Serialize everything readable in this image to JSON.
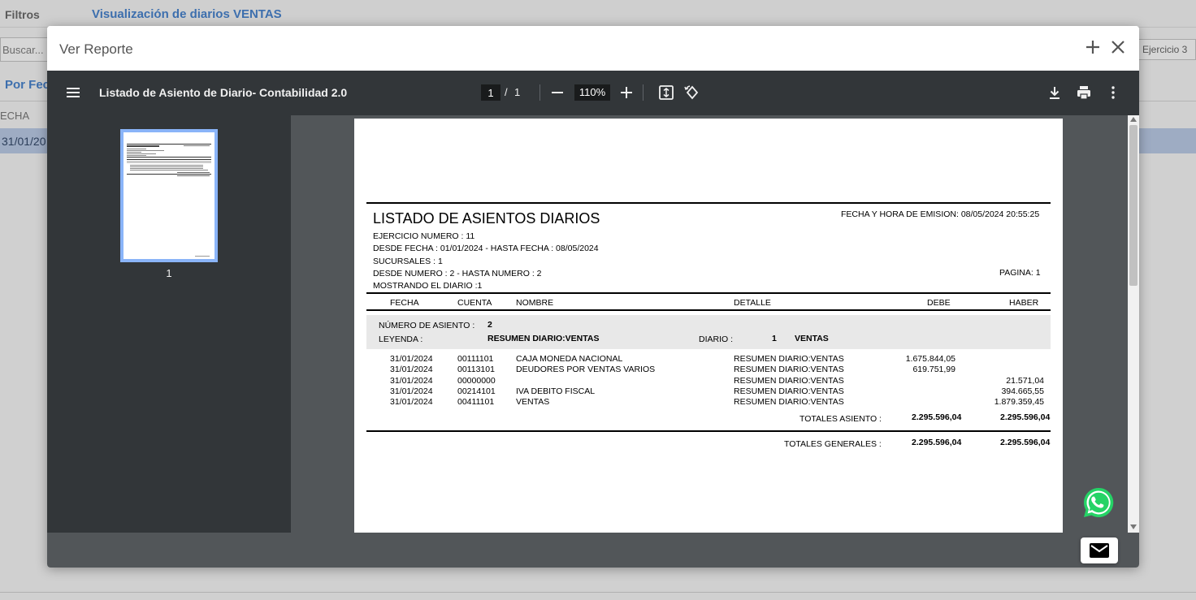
{
  "background": {
    "filtros_label": "Filtros",
    "page_title": "Visualización de diarios VENTAS",
    "search_placeholder": "Buscar...",
    "ejercicio_label": "Ejercicio 3",
    "tab_label": "Por Fec",
    "column_header": "ECHA",
    "row_date": "31/01/20"
  },
  "modal": {
    "title": "Ver Reporte"
  },
  "viewer": {
    "document_title": "Listado de Asiento de Diario- Contabilidad 2.0",
    "current_page": "1",
    "page_separator": "/",
    "total_pages": "1",
    "zoom": "110%",
    "thumbnail_label": "1"
  },
  "report": {
    "title": "LISTADO DE ASIENTOS DIARIOS",
    "emission": "FECHA Y HORA DE EMISION: 08/05/2024 20:55:25",
    "ejercicio": "EJERCICIO NUMERO : 11",
    "fechas": "DESDE FECHA : 01/01/2024 - HASTA FECHA : 08/05/2024",
    "sucursales": "SUCURSALES : 1",
    "numeros": "DESDE NUMERO : 2 - HASTA NUMERO : 2",
    "pagina": "PAGINA: 1",
    "mostrando": "MOSTRANDO EL DIARIO :1",
    "columns": {
      "fecha": "FECHA",
      "cuenta": "CUENTA",
      "nombre": "NOMBRE",
      "detalle": "DETALLE",
      "debe": "DEBE",
      "haber": "HABER"
    },
    "asiento": {
      "numero_label": "NÚMERO DE ASIENTO :",
      "numero": "2",
      "leyenda_label": "LEYENDA :",
      "leyenda": "RESUMEN DIARIO:VENTAS",
      "diario_label": "DIARIO :",
      "diario_num": "1",
      "diario_nombre": "VENTAS"
    },
    "rows": [
      {
        "fecha": "31/01/2024",
        "cuenta": "00111101",
        "nombre": "CAJA MONEDA NACIONAL",
        "detalle": "RESUMEN DIARIO:VENTAS",
        "debe": "1.675.844,05",
        "haber": ""
      },
      {
        "fecha": "31/01/2024",
        "cuenta": "00113101",
        "nombre": "DEUDORES POR VENTAS VARIOS",
        "detalle": "RESUMEN DIARIO:VENTAS",
        "debe": "619.751,99",
        "haber": ""
      },
      {
        "fecha": "31/01/2024",
        "cuenta": "00000000",
        "nombre": "",
        "detalle": "RESUMEN DIARIO:VENTAS",
        "debe": "",
        "haber": "21.571,04"
      },
      {
        "fecha": "31/01/2024",
        "cuenta": "00214101",
        "nombre": "IVA DEBITO FISCAL",
        "detalle": "RESUMEN DIARIO:VENTAS",
        "debe": "",
        "haber": "394.665,55"
      },
      {
        "fecha": "31/01/2024",
        "cuenta": "00411101",
        "nombre": "VENTAS",
        "detalle": "RESUMEN DIARIO:VENTAS",
        "debe": "",
        "haber": "1.879.359,45"
      }
    ],
    "totales_asiento_label": "TOTALES ASIENTO :",
    "totales_asiento_debe": "2.295.596,04",
    "totales_asiento_haber": "2.295.596,04",
    "totales_generales_label": "TOTALES GENERALES :",
    "totales_generales_debe": "2.295.596,04",
    "totales_generales_haber": "2.295.596,04"
  },
  "icons": {
    "menu": "menu-icon",
    "zoom_out": "minus-icon",
    "zoom_in": "plus-icon",
    "fit": "fit-page-icon",
    "rotate": "rotate-icon",
    "download": "download-icon",
    "print": "print-icon",
    "more": "more-vert-icon",
    "whatsapp": "whatsapp-icon",
    "mail": "mail-icon"
  },
  "colors": {
    "accent_blue": "#3d6fae",
    "viewer_toolbar": "#323639",
    "viewer_bg": "#525659",
    "thumb_border": "#8ab4f8",
    "whatsapp_green": "#25d366"
  }
}
